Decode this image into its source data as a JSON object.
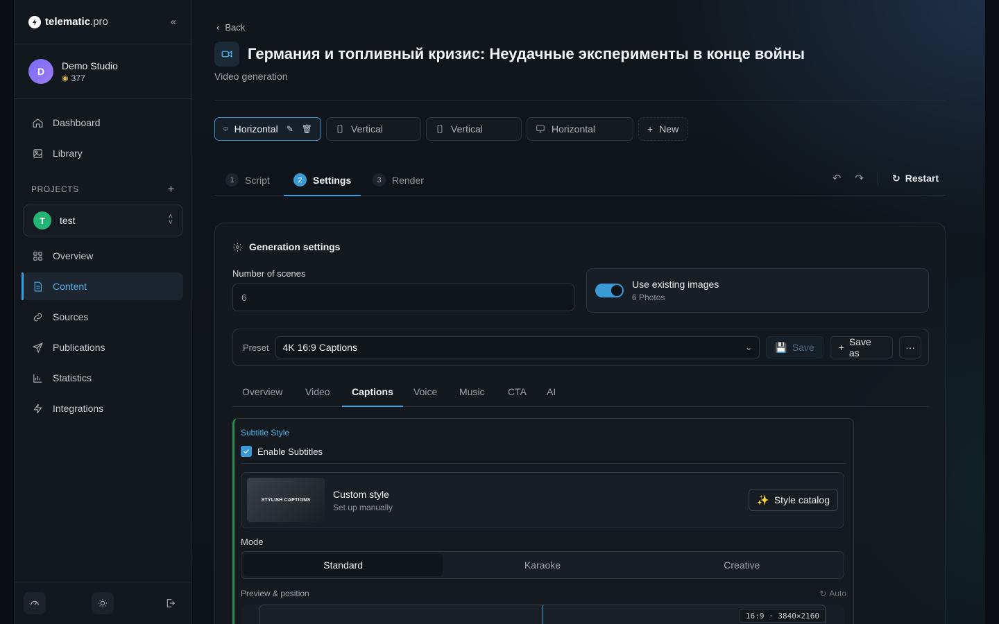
{
  "sidebar": {
    "logo": {
      "main": "telematic",
      "suffix": ".pro"
    },
    "studio": {
      "name": "Demo Studio",
      "credits": "377",
      "initial": "D"
    },
    "nav": [
      {
        "label": "Dashboard",
        "icon": "home-icon"
      },
      {
        "label": "Library",
        "icon": "image-icon"
      }
    ],
    "projects_heading": "PROJECTS",
    "project": {
      "name": "test",
      "initial": "T"
    },
    "project_nav": [
      {
        "label": "Overview",
        "icon": "grid-icon"
      },
      {
        "label": "Content",
        "icon": "document-icon",
        "active": true
      },
      {
        "label": "Sources",
        "icon": "link-icon"
      },
      {
        "label": "Publications",
        "icon": "send-icon"
      },
      {
        "label": "Statistics",
        "icon": "bar-chart-icon"
      },
      {
        "label": "Integrations",
        "icon": "bolt-icon"
      }
    ]
  },
  "header": {
    "back": "Back",
    "title": "Германия и топливный кризис: Неудачные эксперименты в конце войны",
    "subtitle": "Video generation"
  },
  "formats": [
    {
      "label": "Horizontal",
      "icon": "monitor-icon",
      "active": true
    },
    {
      "label": "Vertical",
      "icon": "phone-icon"
    },
    {
      "label": "Vertical",
      "icon": "phone-icon"
    },
    {
      "label": "Horizontal",
      "icon": "monitor-icon"
    }
  ],
  "new_format": "New",
  "steps": [
    {
      "num": "1",
      "label": "Script"
    },
    {
      "num": "2",
      "label": "Settings",
      "active": true
    },
    {
      "num": "3",
      "label": "Render"
    }
  ],
  "restart": "Restart",
  "settings": {
    "heading": "Generation settings",
    "scenes_label": "Number of scenes",
    "scenes_value": "6",
    "existing_title": "Use existing images",
    "existing_sub": "6 Photos",
    "existing_enabled": true,
    "preset_label": "Preset",
    "preset_value": "4K 16:9 Captions",
    "save": "Save",
    "save_as": "Save as",
    "more": "···"
  },
  "sub_tabs": [
    "Overview",
    "Video",
    "Captions",
    "Voice",
    "Music",
    "CTA",
    "AI"
  ],
  "active_sub_tab": "Captions",
  "captions": {
    "section": "Subtitle Style",
    "enable_label": "Enable Subtitles",
    "enabled": true,
    "thumb_text": "STYLISH CAPTIONS",
    "style_title": "Custom style",
    "style_sub": "Set up manually",
    "catalog_btn": "Style catalog",
    "mode_label": "Mode",
    "modes": [
      "Standard",
      "Karaoke",
      "Creative"
    ],
    "active_mode": "Standard",
    "preview_label": "Preview & position",
    "auto": "Auto",
    "resolution": "16:9 · 3840×2160"
  },
  "colors": {
    "accent": "#3aa0e0",
    "success": "#22b573",
    "avatar": "#7b6cf6"
  }
}
